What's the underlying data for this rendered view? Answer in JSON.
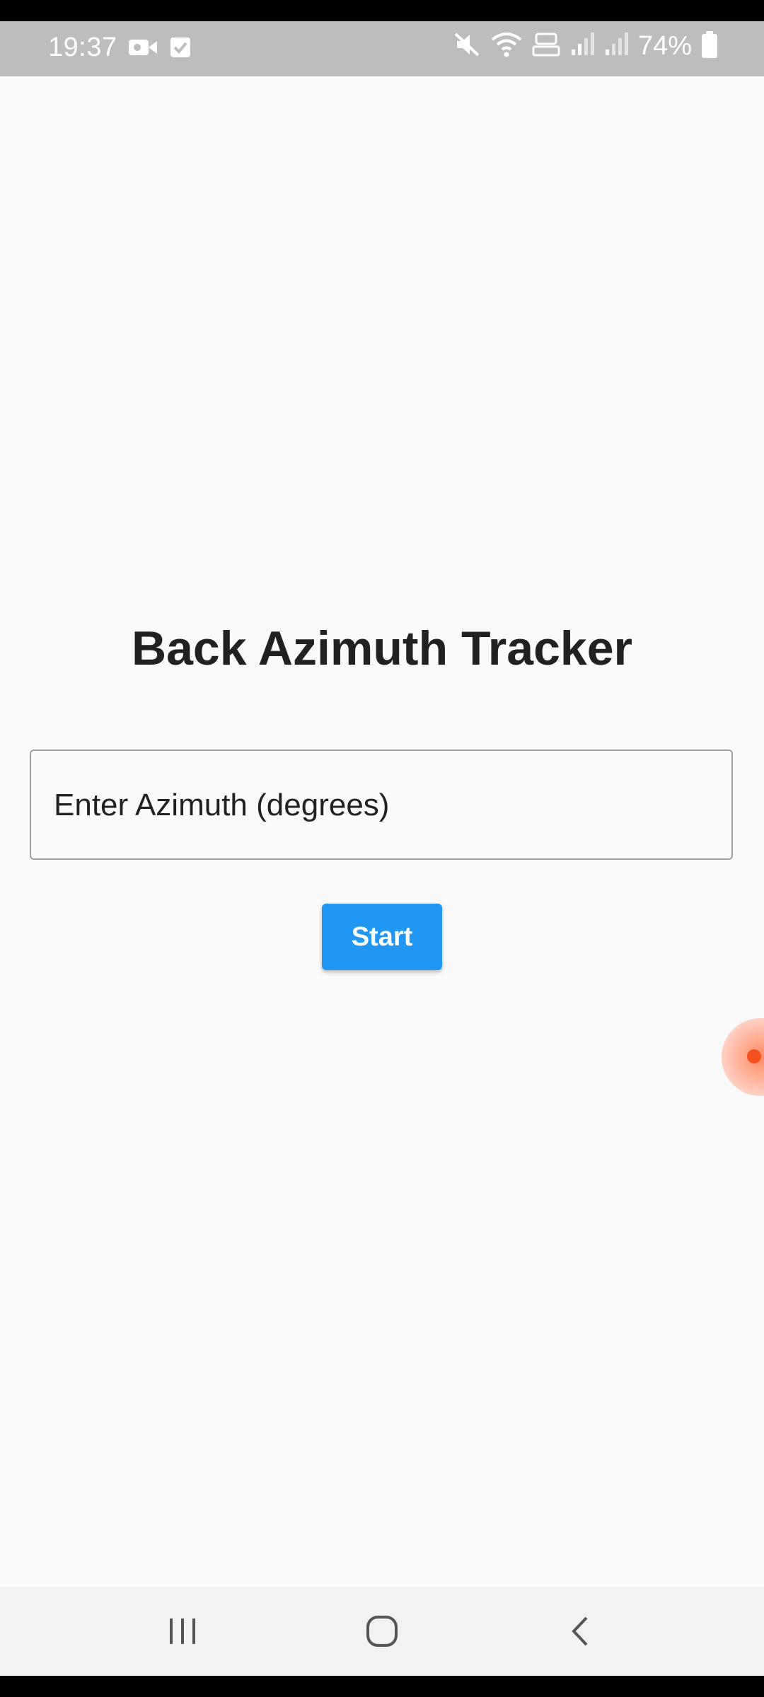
{
  "status_bar": {
    "time": "19:37",
    "battery": "74%",
    "icons": [
      "video-camera-icon",
      "checkbox-icon",
      "mute-icon",
      "wifi-icon",
      "volte-icon",
      "signal-icon",
      "signal-icon",
      "battery-icon"
    ]
  },
  "app": {
    "title": "Back Azimuth Tracker",
    "azimuth_input": {
      "placeholder": "Enter Azimuth (degrees)",
      "value": ""
    },
    "start_button_label": "Start"
  },
  "navigation_bar": {
    "buttons": [
      "recent-apps-icon",
      "home-icon",
      "back-icon"
    ]
  },
  "colors": {
    "accent": "#2196f3",
    "background": "#fafafa",
    "status_bar": "#bdbdbd"
  }
}
